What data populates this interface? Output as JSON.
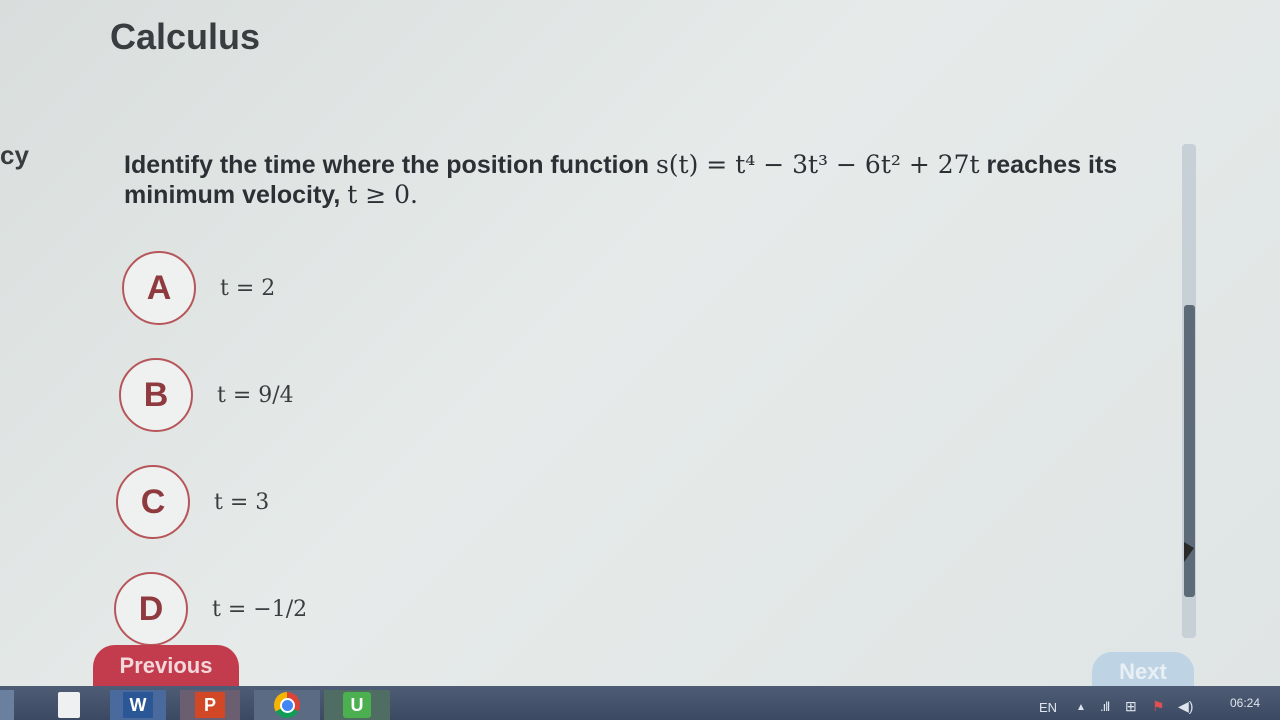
{
  "header": {
    "title": "Calculus"
  },
  "sidebar_fragment": "cy",
  "question": {
    "text_before": "Identify the time where the position function ",
    "formula": "s(t) = t⁴ − 3t³ − 6t² + 27t",
    "text_after": " reaches its minimum velocity, ",
    "condition": "t ≥ 0."
  },
  "options": [
    {
      "letter": "A",
      "value": "t = 2"
    },
    {
      "letter": "B",
      "value": "t = 9/4"
    },
    {
      "letter": "C",
      "value": "t = 3"
    },
    {
      "letter": "D",
      "value": "t = −1/2"
    }
  ],
  "nav": {
    "previous_label": "Previous",
    "next_label": "Next"
  },
  "taskbar": {
    "apps": [
      {
        "name": "file-icon",
        "label": ""
      },
      {
        "name": "word-icon",
        "label": "W"
      },
      {
        "name": "powerpoint-icon",
        "label": "P"
      },
      {
        "name": "chrome-icon",
        "label": ""
      },
      {
        "name": "u-app-icon",
        "label": "U"
      }
    ],
    "language": "EN",
    "clock": "06:24"
  },
  "colors": {
    "accent_red": "#c23c4d",
    "option_border": "#b7565a",
    "next_disabled": "#bed3e3"
  }
}
